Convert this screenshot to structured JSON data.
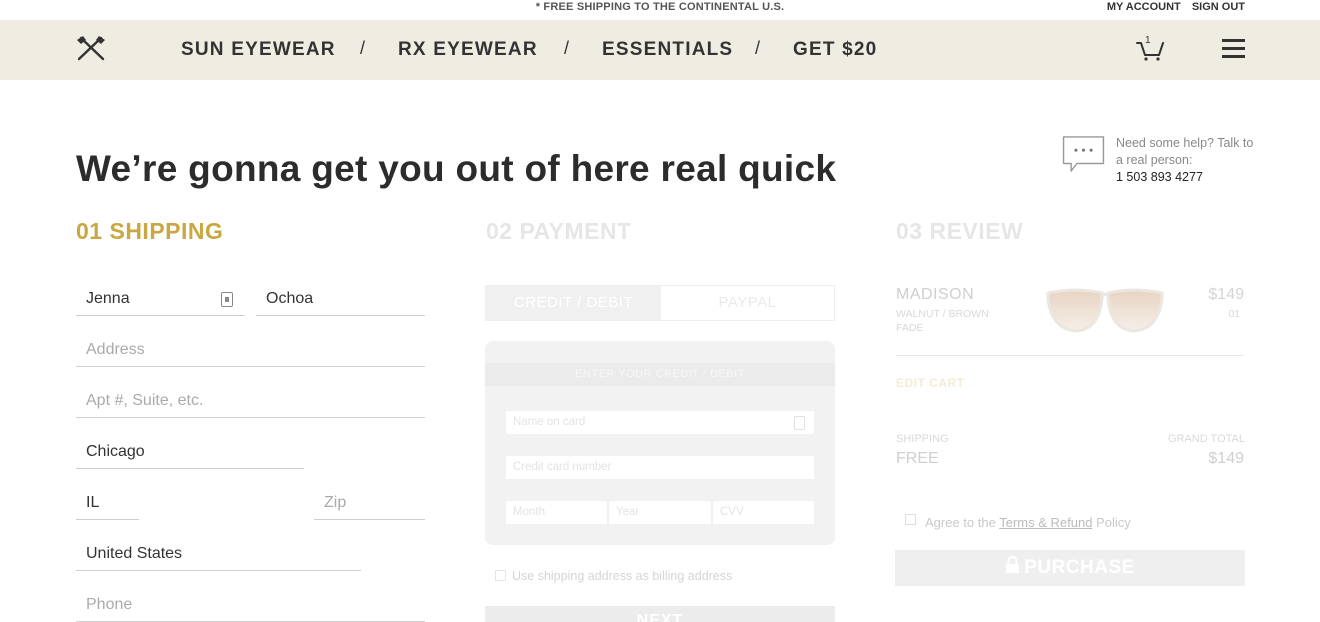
{
  "topbar": {
    "promo": "* FREE SHIPPING TO THE CONTINENTAL U.S.",
    "my_account": "MY ACCOUNT",
    "sign_out": "SIGN OUT"
  },
  "nav": {
    "items": [
      "SUN EYEWEAR",
      "RX EYEWEAR",
      "ESSENTIALS",
      "GET $20"
    ],
    "separator": "/",
    "cart_count": "1"
  },
  "headline": "We’re gonna get you out of here real quick",
  "help": {
    "line1": "Need some help? Talk to a real person:",
    "phone": "1 503 893 4277"
  },
  "steps": {
    "shipping": "01 SHIPPING",
    "payment": "02 PAYMENT",
    "review": "03 REVIEW"
  },
  "shipping": {
    "first_name": "Jenna",
    "last_name": "Ochoa",
    "address_placeholder": "Address",
    "apt_placeholder": "Apt #, Suite, etc.",
    "city": "Chicago",
    "state": "IL",
    "zip_placeholder": "Zip",
    "country": "United States",
    "phone_placeholder": "Phone"
  },
  "payment": {
    "tab_card": "CREDIT / DEBIT",
    "tab_paypal": "PAYPAL",
    "card_header": "ENTER YOUR CREDIT / DEBIT",
    "name_placeholder": "Name on card",
    "number_placeholder": "Credit card number",
    "month_placeholder": "Month",
    "year_placeholder": "Year",
    "cvv_placeholder": "CVV",
    "billing_label": "Use shipping address as billing address",
    "next_label": "NEXT"
  },
  "review": {
    "product_name": "MADISON",
    "product_color": "WALNUT / BROWN FADE",
    "price": "$149",
    "qty": "01",
    "edit_cart": "EDIT CART",
    "shipping_label": "SHIPPING",
    "shipping_value": "FREE",
    "total_label": "GRAND TOTAL",
    "total_value": "$149",
    "agree_prefix": "Agree to the",
    "agree_link": "Terms & Refund",
    "agree_suffix": "Policy",
    "purchase_label": "PURCHASE"
  },
  "colors": {
    "accent": "#c9a743",
    "nav_bg": "#efece1"
  }
}
